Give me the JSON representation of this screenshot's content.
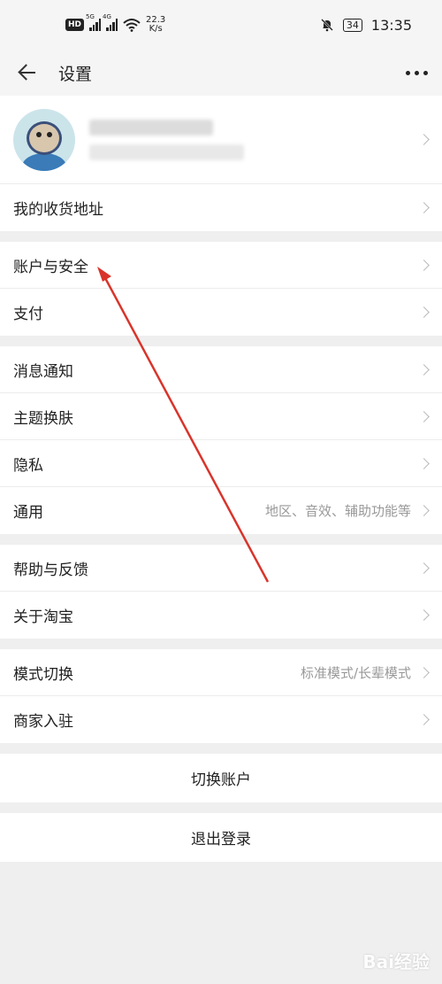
{
  "status_bar": {
    "hd_label": "HD",
    "sim1_label": "5G",
    "sim2_label": "4G",
    "speed_value": "22.3",
    "speed_unit": "K/s",
    "battery": "34",
    "time": "13:35"
  },
  "header": {
    "title": "设置"
  },
  "sections": [
    {
      "rows": [
        {
          "label": "我的收货地址",
          "hint": ""
        }
      ]
    },
    {
      "rows": [
        {
          "label": "账户与安全",
          "hint": ""
        },
        {
          "label": "支付",
          "hint": ""
        }
      ]
    },
    {
      "rows": [
        {
          "label": "消息通知",
          "hint": ""
        },
        {
          "label": "主题换肤",
          "hint": ""
        },
        {
          "label": "隐私",
          "hint": ""
        },
        {
          "label": "通用",
          "hint": "地区、音效、辅助功能等"
        }
      ]
    },
    {
      "rows": [
        {
          "label": "帮助与反馈",
          "hint": ""
        },
        {
          "label": "关于淘宝",
          "hint": ""
        }
      ]
    },
    {
      "rows": [
        {
          "label": "模式切换",
          "hint": "标准模式/长辈模式"
        },
        {
          "label": "商家入驻",
          "hint": ""
        }
      ]
    }
  ],
  "actions": {
    "switch_account": "切换账户",
    "logout": "退出登录"
  },
  "watermark": "Bai经验",
  "colors": {
    "background": "#efefef",
    "annotation_arrow": "#d9342b"
  }
}
